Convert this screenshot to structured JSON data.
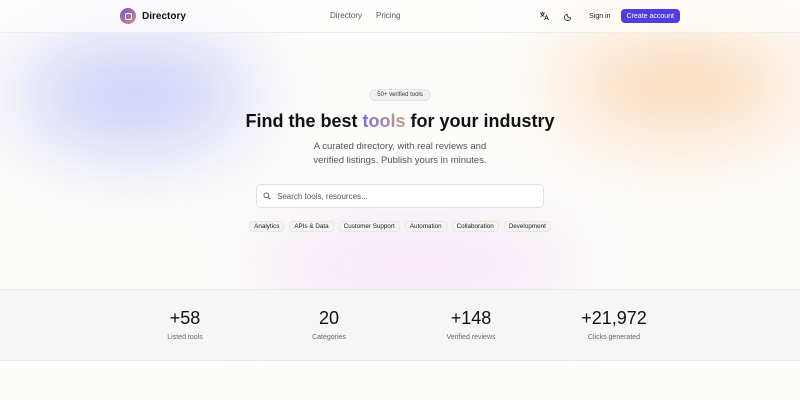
{
  "brand": {
    "name": "Directory"
  },
  "nav": {
    "items": [
      "Directory",
      "Pricing"
    ]
  },
  "header": {
    "translate_icon": "translate-icon",
    "theme_icon": "moon-icon",
    "signin_label": "Sign in",
    "create_label": "Create account",
    "accent_color": "#4f3de0"
  },
  "hero": {
    "badge": "50+ verified tools",
    "headline_pre": "Find the best ",
    "headline_highlight": "tools",
    "headline_post": " for your industry",
    "subline": "A curated directory, with real reviews and verified listings. Publish yours in minutes.",
    "search_placeholder": "Search tools, resources...",
    "chips": [
      "Analytics",
      "APIs & Data",
      "Customer Support",
      "Automation",
      "Collaboration",
      "Development"
    ]
  },
  "stats": [
    {
      "value": "+58",
      "label": "Listed tools"
    },
    {
      "value": "20",
      "label": "Categories"
    },
    {
      "value": "+148",
      "label": "Verified reviews"
    },
    {
      "value": "+21,972",
      "label": "Clicks generated"
    }
  ]
}
